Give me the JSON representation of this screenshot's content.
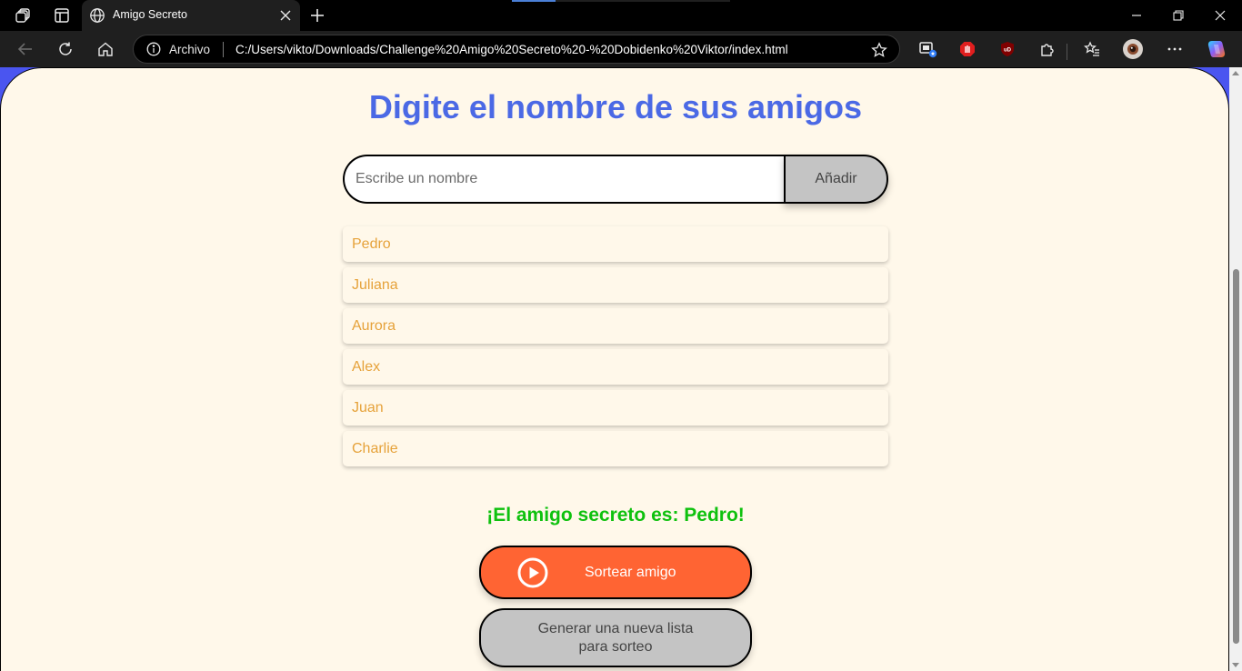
{
  "browser": {
    "tab": {
      "title": "Amigo Secreto",
      "icon": "globe-icon"
    },
    "address": {
      "scheme_label": "Archivo",
      "url": "C:/Users/vikto/Downloads/Challenge%20Amigo%20Secreto%20-%20Dobidenko%20Viktor/index.html"
    },
    "extensions": [
      "screencast-icon",
      "adblock-icon",
      "ublock-icon",
      "puzzle-icon",
      "favorites-icon",
      "profile-avatar",
      "more-icon",
      "copilot-icon"
    ]
  },
  "page": {
    "title": "Digite el nombre de sus amigos",
    "input": {
      "placeholder": "Escribe un nombre",
      "value": ""
    },
    "add_button": "Añadir",
    "friends": [
      "Pedro",
      "Juliana",
      "Aurora",
      "Alex",
      "Juan",
      "Charlie"
    ],
    "result": "¡El amigo secreto es: Pedro!",
    "draw_button": "Sortear amigo",
    "reset_button": "Generar una nueva lista para sorteo"
  },
  "colors": {
    "title": "#4b69e5",
    "background": "#fff8ea",
    "outer": "#4a55f0",
    "friend_text": "#e6a23a",
    "result": "#0ec10e",
    "draw_button": "#ff6433",
    "secondary_button": "#c4c4c4"
  }
}
